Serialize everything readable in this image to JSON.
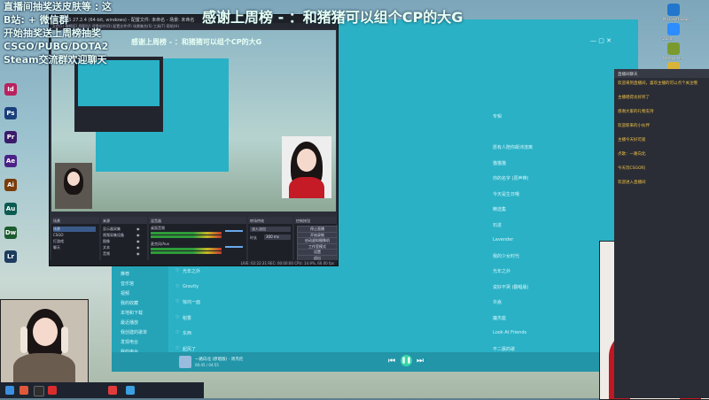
{
  "overlay": {
    "lines": [
      "直播间抽奖送皮肤等 : 这",
      "B站: + 微信群",
      "开始抽奖送上周榜抽奖",
      "CSGO/PUBG/DOTA2",
      "Steam交流群欢迎聊天"
    ],
    "banner": "感谢上周榜 - ：和猪猪可以组个CP的大G"
  },
  "desktop_icons_left": [
    {
      "name": "indesign-icon",
      "text": "Id",
      "color": "#b8225e"
    },
    {
      "name": "photoshop-icon",
      "text": "Ps",
      "color": "#1a3f7a"
    },
    {
      "name": "premiere-icon",
      "text": "Pr",
      "color": "#3b1c6b"
    },
    {
      "name": "adobe-express-icon",
      "text": "Ae",
      "color": "#4b2386"
    },
    {
      "name": "illustrator-icon",
      "text": "Ai",
      "color": "#7a3c0a"
    },
    {
      "name": "audition-icon",
      "text": "Au",
      "color": "#0b5a52"
    },
    {
      "name": "dreamweaver-icon",
      "text": "Dw",
      "color": "#1b5c2e"
    },
    {
      "name": "lightroom-icon",
      "text": "Lr",
      "color": "#1d3c5e"
    }
  ],
  "desktop_icons_right": [
    {
      "name": "edge-icon",
      "label": "Microsoft Edge",
      "color": "#2277cc"
    },
    {
      "name": "zoom-icon",
      "label": "Zoom",
      "color": "#2d8cff"
    },
    {
      "name": "notepad-icon",
      "label": "Notepad++",
      "color": "#7a9a2e"
    },
    {
      "name": "game-icon",
      "label": "",
      "color": "#d9b43a"
    }
  ],
  "obs": {
    "title": "OBS 27.2.4 (64-bit, windows) - 配置文件: 未命名 - 场景: 未命名",
    "menu": "文件(F)  编辑(E)  视图(V)  停靠部件(D)  配置文件(P)  场景集合(S)  工具(T)  帮助(H)",
    "preview_banner": "感谢上周榜 - ：和猪猪可以组个CP的大G",
    "docks": {
      "scenes": {
        "title": "场景",
        "items": [
          "场景",
          "CSGO",
          "打游戏",
          "聊天"
        ]
      },
      "sources": {
        "title": "来源",
        "items": [
          "显示器采集",
          "视频采集设备",
          "图像",
          "文本",
          "音频"
        ]
      },
      "mixer": {
        "title": "混音器",
        "channels": [
          "桌面音频",
          "麦克风/Aux"
        ]
      },
      "transitions": {
        "title": "转场特效",
        "value": "淡入淡出",
        "duration_label": "时长",
        "duration": "300 ms"
      },
      "controls": {
        "title": "控制按钮",
        "buttons": [
          "停止直播",
          "开始录制",
          "启动虚拟摄像机",
          "工作室模式",
          "设置",
          "退出"
        ]
      }
    },
    "status": "LIVE: 02:22:31   REC: 00:00:00   CPU: 14.9%, 60.00 fps"
  },
  "music": {
    "search_placeholder": "搜索",
    "sidebar": [
      "推荐",
      "音乐馆",
      "视频",
      "我的收藏",
      "本地和下载",
      "最近播放",
      "我创建的歌单",
      "发现电台",
      "我的电台"
    ],
    "rows": [
      {
        "song": "标题",
        "artist": "歌手",
        "album": "专辑"
      },
      {
        "song": "DJ",
        "artist": "",
        "album": ""
      },
      {
        "song": "平凡之路 (Live)",
        "artist": "",
        "album": "愿有人陪你颠沛流离"
      },
      {
        "song": "无敌猫",
        "artist": "",
        "album": "猫猫猫"
      },
      {
        "song": "MEGA (原唱版)",
        "artist": "",
        "album": "你的名字 (原声带)"
      },
      {
        "song": "HAPPY BIRTHDAY",
        "artist": "",
        "album": "今天是生日哦"
      },
      {
        "song": "约翰",
        "artist": "",
        "album": "精选集"
      },
      {
        "song": "夜的钢琴曲",
        "artist": "",
        "album": "石进"
      },
      {
        "song": "LAVENDER LOVE",
        "artist": "",
        "album": "Lavender"
      },
      {
        "song": "小幸运",
        "artist": "",
        "album": "我的少女时代"
      },
      {
        "song": "光年之外",
        "artist": "",
        "album": "光年之外"
      },
      {
        "song": "Gravity",
        "artist": "",
        "album": "说好不哭 (翻唱版)"
      },
      {
        "song": "惊鸿一面",
        "artist": "",
        "album": "许嵩"
      },
      {
        "song": "稻香",
        "artist": "",
        "album": "魔杰座"
      },
      {
        "song": "东西",
        "artist": "",
        "album": "Look At Friends"
      },
      {
        "song": "起风了",
        "artist": "",
        "album": "不二晨的歌"
      },
      {
        "song": "起风了 (吉他版)",
        "artist": "",
        "album": "起风了 (吉他版)"
      }
    ],
    "now_playing": "一路向北 (原唱版) - 周杰伦",
    "time": "00:45 / 04:55"
  },
  "chat": {
    "header": "直播间聊天",
    "messages": [
      "欢迎来到直播间，喜欢主播的可以点个关注哦",
      "主播唱得太好听了",
      "感谢大家的礼物支持",
      "欢迎新来的小伙伴",
      "主播今天好可爱",
      "点歌：一路向北",
      "今天玩CSGO吗",
      "欢迎进入直播间"
    ]
  },
  "colors": {
    "music_bg": "#2ab1c6",
    "obs_bg": "#2b2e38",
    "chat_bg": "#2a2d35",
    "banner_text": "#e8fff4"
  }
}
